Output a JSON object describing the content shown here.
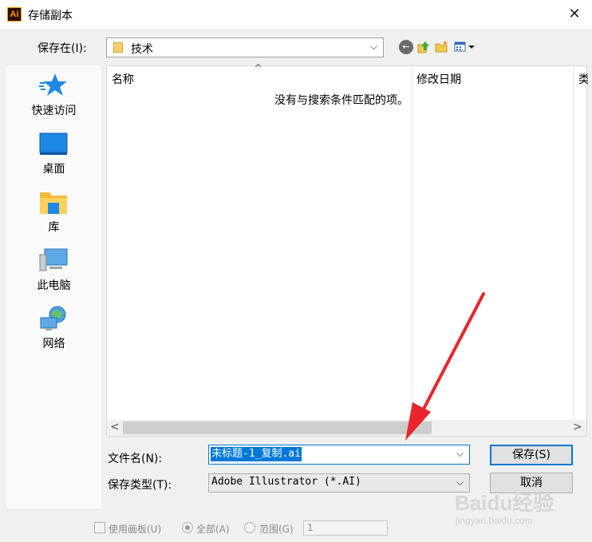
{
  "window": {
    "app_icon": "Ai",
    "title": "存储副本",
    "close_glyph": "✕"
  },
  "location": {
    "label": "保存在(I):",
    "value": "技术",
    "dropdown_glyph": "⌵"
  },
  "toolbar": {
    "back_glyph": "←"
  },
  "places": [
    {
      "label": "快速访问",
      "icon": "star-icon"
    },
    {
      "label": "桌面",
      "icon": "desktop-icon"
    },
    {
      "label": "库",
      "icon": "library-icon"
    },
    {
      "label": "此电脑",
      "icon": "computer-icon"
    },
    {
      "label": "网络",
      "icon": "network-icon"
    }
  ],
  "file_list": {
    "columns": [
      "名称",
      "修改日期",
      "类"
    ],
    "sort_glyph": "^",
    "empty_message": "没有与搜索条件匹配的项。",
    "scroll_left_glyph": "<",
    "scroll_right_glyph": ">"
  },
  "filename": {
    "label": "文件名(N):",
    "value": "未标题-1_复制.ai",
    "dropdown_glyph": "⌵"
  },
  "filetype": {
    "label": "保存类型(T):",
    "value": "Adobe Illustrator (*.AI)",
    "dropdown_glyph": "⌵"
  },
  "buttons": {
    "save": "保存(S)",
    "cancel": "取消"
  },
  "options": {
    "use_artboards": "使用画板(U)",
    "all": "全部(A)",
    "range": "范围(G)",
    "range_value": "1"
  },
  "watermark": {
    "logo": "Baidu经验",
    "url": "jingyan.baidu.com"
  },
  "colors": {
    "accent": "#0078d7",
    "annotation": "#e8262b"
  }
}
